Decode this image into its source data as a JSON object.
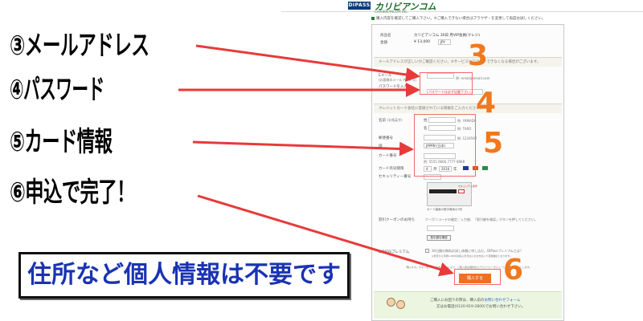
{
  "header": {
    "logo_text": "DIPASS",
    "logo_jp": "カリビアンコム",
    "logo_sub": "CARIBBEANCOM INC.",
    "intro": "購入内容を確認してご購入下さい。※ご購入できない場合はブラウザ・を変更して再度お試しください。"
  },
  "product": {
    "name_label": "商品名",
    "name_value": "カリビアンコム 30日 月VIP会員(クレジ)",
    "price_label": "金額",
    "price_value": "¥ 13,000",
    "currency": "JPY"
  },
  "email_section": {
    "heading": "メールアドレスが正しいかご確認ください。※サービスにログインできなくなる場合がございます。",
    "email_label": "Eメール",
    "email_sub": "(お客様のメールアドレス)",
    "email_example": "例: email@email.com",
    "password_label": "パスワードを入力",
    "password_hint": "パスワードは必ず記載下さい。"
  },
  "card_section": {
    "heading": "クレジットカード会社に登録されている情報をご入力ください。",
    "name_label": "名前",
    "name_sub": "(半角英字)",
    "last_name_prefix": "姓",
    "first_name_prefix": "名",
    "last_name_example": "例: YAMADA",
    "first_name_example": "例: TARO",
    "zip_label": "郵便番号",
    "zip_example": "例: 1234567",
    "country_label": "国",
    "country_value": "JAPAN (日本)",
    "card_number_label": "カード番号",
    "card_number_example": "例: 5555 6666 7777 8888",
    "expiry_label": "カード有効期限",
    "expiry_month": "4",
    "expiry_month_unit": "月",
    "expiry_year": "2016",
    "expiry_year_unit": "年",
    "security_label": "セキュリティー番号",
    "card_caption": "カード裏面の数字最後の3桁",
    "security_tag": "セキュリティ番号"
  },
  "coupon": {
    "label": "割引クーポンのお持ち",
    "text": "クーポンコードの確定／入力後、「割引額を確認」ボタンを押してください。",
    "button_label": "割引額を確認"
  },
  "premium": {
    "label": "DIPASSプレミアム",
    "text": "30日間の無料お試し体験に申し込む。DIPassプレミアムとは？",
    "subtext": "※翌月から月額1,480円(税込)を月払いのお支払いで自動継続となります。"
  },
  "submit": {
    "note": "「購入する」ボタンをクリックすることにより、ご購入者は規約及びプライバシーポリシーに同意するものとします。",
    "button_label": "購入する"
  },
  "help": {
    "line1_prefix": "ご購入にお困りの際は、購入前の",
    "line1_link": "お問い合わせフォーム",
    "line2": "又はお電話(0120-919-2800)でお問い合わせ下さい。"
  },
  "annotations": {
    "step3": "③メールアドレス",
    "step4": "④パスワード",
    "step5": "⑤カード情報",
    "step6": "⑥申込で完了！",
    "num3": "3",
    "num4": "4",
    "num5": "5",
    "num6": "6",
    "banner": "住所など個人情報は不要です"
  },
  "colors": {
    "accent_orange": "#f07820",
    "banner_blue": "#1a33b3",
    "highlight_red": "#f06b6b",
    "arrow_red": "#e83a3a"
  }
}
